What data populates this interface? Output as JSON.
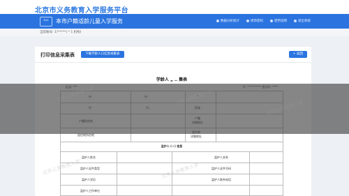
{
  "header": {
    "site_title": "北京市义务教育入学服务平台",
    "logo_text": "¹ᵁᶜ",
    "subtitle": "本市户籍适龄儿童入学服务",
    "nav": [
      "数据分析统计",
      "修改密码",
      "使用说明",
      "退出系统"
    ]
  },
  "breadcrumb": "当前账号: 1?*****( * 1 机构)",
  "page": {
    "title": "打印信息采集表",
    "download_label": "下载学龄人口信息采集表",
    "back_label": "+ 返回"
  },
  "document": {
    "title": "学龄人 „ ‥ 集表",
    "meta_left": "区县: ***",
    "meta_right": "号: ********** 登记时: ****",
    "rows": [
      {
        "left": "\u0001",
        "mid": "\u0001",
        "right": "*"
      },
      {
        "left": "\u0001",
        "mid": "\u0001 ,",
        "right": "民族"
      },
      {
        "left": "户籍所在地",
        "mid": "",
        "right": "户籍\n详细地址"
      },
      {
        "left": "居住地所在地",
        "mid": "",
        "right": "居住地\n详细地址"
      },
      {
        "section": "监护人 (一) 信息"
      },
      {
        "left": "监护人姓名",
        "mid": "",
        "right": "监护人关系"
      },
      {
        "left": "监护人证件类型",
        "mid": "",
        "right": "监护人证件号码"
      },
      {
        "left": "监护人学历",
        "mid": "",
        "right": "监护人联系电话"
      },
      {
        "left": "监护人工作单位",
        "mid": "",
        "right": ""
      }
    ]
  },
  "watermark_text": "北京义务教育入学"
}
